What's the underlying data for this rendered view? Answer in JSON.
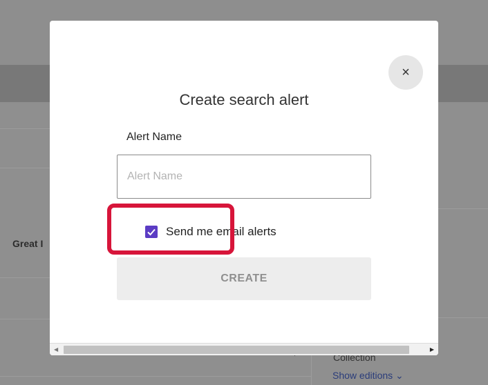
{
  "background": {
    "partial_text": "Great I",
    "collection_text": "Collection",
    "editions_link": "Show editions ⌄"
  },
  "modal": {
    "title": "Create search alert",
    "close_glyph": "×",
    "alert_name_label": "Alert Name",
    "alert_name_placeholder": "Alert Name",
    "alert_name_value": "",
    "email_alerts_label": "Send me email alerts",
    "email_alerts_checked": true,
    "create_button_label": "CREATE"
  },
  "colors": {
    "checkbox_accent": "#5b3cc4",
    "highlight": "#d7153a"
  },
  "icons": {
    "close": "close-icon",
    "check": "checkmark-icon",
    "dropdown": "caret-down-icon",
    "scroll_left": "arrow-left-icon",
    "scroll_right": "arrow-right-icon"
  }
}
